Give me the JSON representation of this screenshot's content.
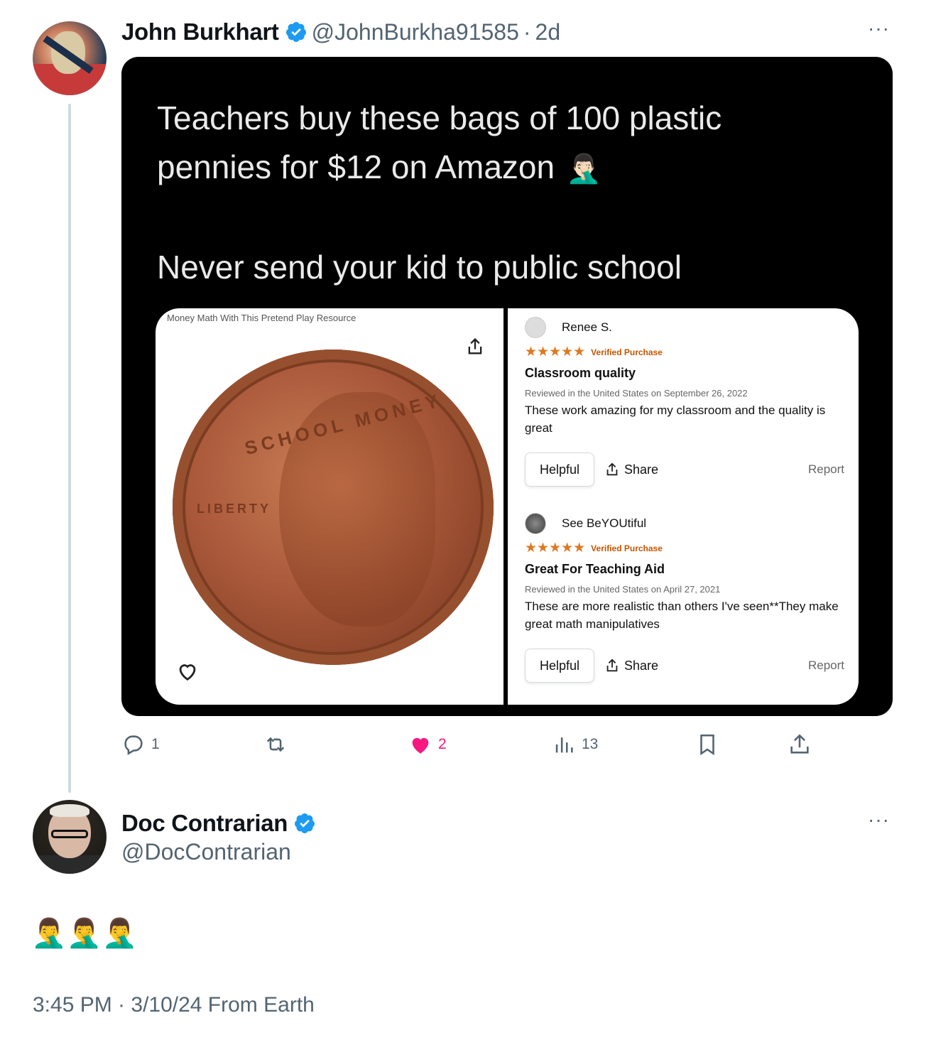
{
  "tweet1": {
    "display_name": "John Burkhart",
    "handle": "@JohnBurkha91585",
    "separator": "·",
    "time": "2d",
    "more": "···",
    "verified": true,
    "media": {
      "line1": "Teachers buy these bags of 100 plastic",
      "line2": "pennies for $12 on Amazon",
      "line2_emoji": "🤦🏻‍♂️",
      "line3": "Never send your kid to public school",
      "card": {
        "caption": "Money Math With This Pretend Play Resource",
        "coin_top_text": "SCHOOL MONEY",
        "coin_left_text": "LIBERTY",
        "reviews": [
          {
            "user": "Renee S.",
            "stars": "★★★★★",
            "verified_purchase": "Verified Purchase",
            "title": "Classroom quality",
            "date": "Reviewed in the United States on September 26, 2022",
            "body": "These work amazing for my classroom and the quality is great",
            "helpful": "Helpful",
            "share": "Share",
            "report": "Report"
          },
          {
            "user": "See BeYOUtiful",
            "stars": "★★★★★",
            "verified_purchase": "Verified Purchase",
            "title": "Great For Teaching Aid",
            "date": "Reviewed in the United States on April 27, 2021",
            "body": "These are more realistic than others I've seen**They make great math manipulatives",
            "helpful": "Helpful",
            "share": "Share",
            "report": "Report"
          }
        ]
      }
    },
    "actions": {
      "replies": "1",
      "likes": "2",
      "views": "13"
    }
  },
  "tweet2": {
    "display_name": "Doc Contrarian",
    "handle": "@DocContrarian",
    "more": "···",
    "verified": true,
    "text": "🤦‍♂️🤦‍♂️🤦‍♂️",
    "timestamp": "3:45 PM · 3/10/24 From Earth"
  },
  "colors": {
    "verified_blue": "#1d9bf0",
    "like_pink": "#f91880",
    "secondary_text": "#536471",
    "thread_line": "#cfd9de",
    "star_orange": "#de7921"
  }
}
